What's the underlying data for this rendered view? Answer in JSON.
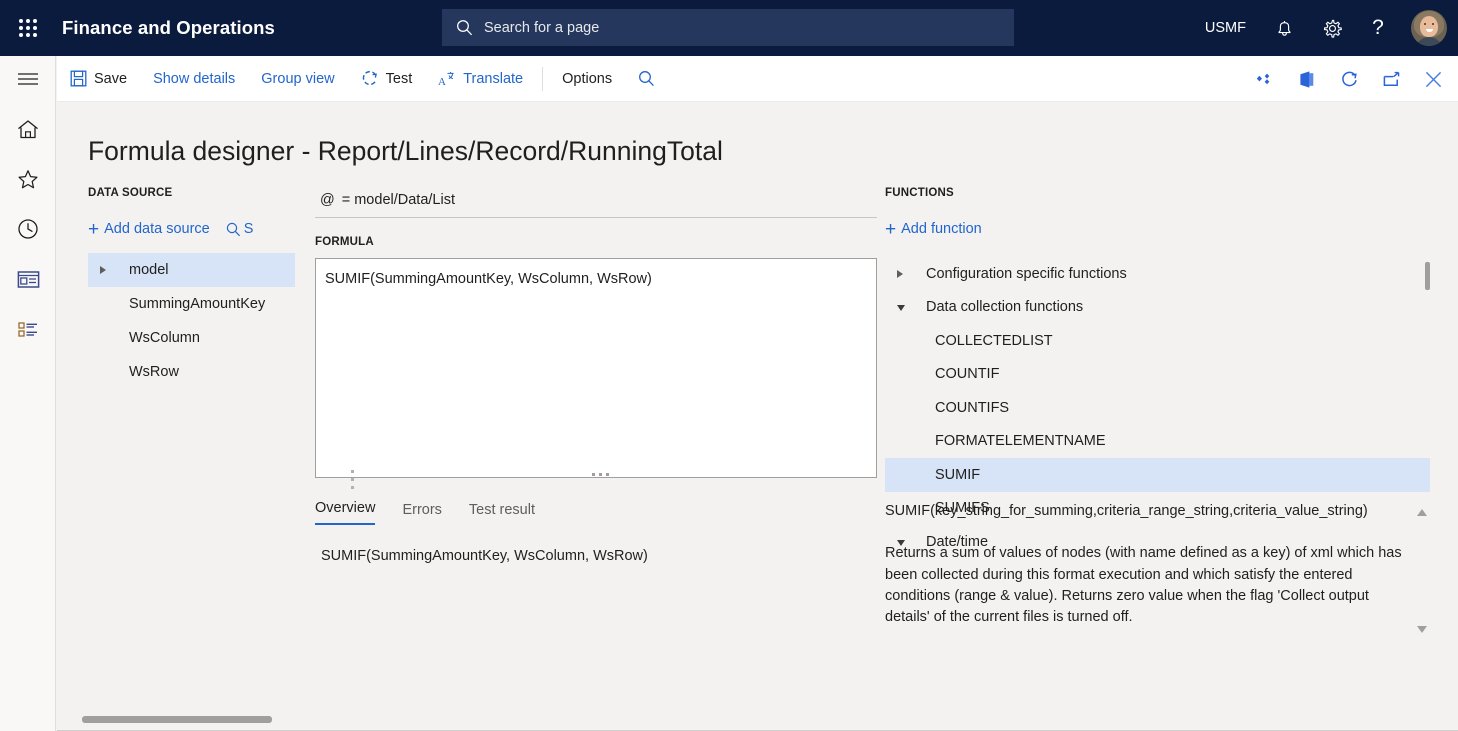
{
  "topbar": {
    "waffle_icon": "app-launcher-icon",
    "app_title": "Finance and Operations",
    "search": {
      "placeholder": "Search for a page",
      "icon": "search-icon"
    },
    "company": "USMF",
    "notifications_icon": "bell-icon",
    "settings_icon": "gear-icon",
    "help_label": "?",
    "avatar": "user-avatar"
  },
  "rail": {
    "items": [
      {
        "name": "hamburger-menu-icon",
        "label": "Expand the navigation pane"
      },
      {
        "name": "home-icon",
        "label": "Home"
      },
      {
        "name": "star-icon",
        "label": "Favorites"
      },
      {
        "name": "clock-icon",
        "label": "Recent"
      },
      {
        "name": "workspaces-icon",
        "label": "Workspaces"
      },
      {
        "name": "modules-list-icon",
        "label": "Modules"
      }
    ]
  },
  "commandbar": {
    "save_label": "Save",
    "show_details_label": "Show details",
    "group_view_label": "Group view",
    "test_label": "Test",
    "translate_label": "Translate",
    "options_label": "Options",
    "search_icon": "search-icon",
    "right_icons": [
      "share-diamond-icon",
      "office-app-icon",
      "refresh-icon",
      "popout-icon",
      "close-icon"
    ]
  },
  "page": {
    "title": "Formula designer - Report/Lines/Record/RunningTotal"
  },
  "datasource": {
    "section_label": "DATA SOURCE",
    "add_label": "Add data source",
    "search_label": "S",
    "tree": [
      {
        "label": "model",
        "indent": 0,
        "expander": "collapsed",
        "selected": true
      },
      {
        "label": "SummingAmountKey",
        "indent": 1,
        "expander": "none",
        "selected": false
      },
      {
        "label": "WsColumn",
        "indent": 1,
        "expander": "none",
        "selected": false
      },
      {
        "label": "WsRow",
        "indent": 1,
        "expander": "none",
        "selected": false
      }
    ]
  },
  "center": {
    "binding_symbol": "@",
    "binding_value": "= model/Data/List",
    "formula_label": "FORMULA",
    "formula_value": "SUMIF(SummingAmountKey, WsColumn, WsRow)",
    "tabs": [
      {
        "label": "Overview",
        "active": true
      },
      {
        "label": "Errors",
        "active": false
      },
      {
        "label": "Test result",
        "active": false
      }
    ],
    "overview_text": "SUMIF(SummingAmountKey, WsColumn, WsRow)"
  },
  "functions": {
    "section_label": "FUNCTIONS",
    "add_label": "Add function",
    "tree": [
      {
        "label": "Configuration specific functions",
        "type": "group",
        "expander": "collapsed",
        "selected": false
      },
      {
        "label": "Data collection functions",
        "type": "group",
        "expander": "expanded",
        "selected": false
      },
      {
        "label": "COLLECTEDLIST",
        "type": "leaf",
        "expander": "none",
        "selected": false
      },
      {
        "label": "COUNTIF",
        "type": "leaf",
        "expander": "none",
        "selected": false
      },
      {
        "label": "COUNTIFS",
        "type": "leaf",
        "expander": "none",
        "selected": false
      },
      {
        "label": "FORMATELEMENTNAME",
        "type": "leaf",
        "expander": "none",
        "selected": false
      },
      {
        "label": "SUMIF",
        "type": "leaf",
        "expander": "none",
        "selected": true
      },
      {
        "label": "SUMIFS",
        "type": "leaf",
        "expander": "none",
        "selected": false
      },
      {
        "label": "Date/time",
        "type": "group",
        "expander": "expanded",
        "selected": false
      }
    ],
    "description": {
      "signature": "SUMIF(key_string_for_summing,criteria_range_string,criteria_value_string)",
      "body": "Returns a sum of values of nodes (with name defined as a key) of xml which has been collected during this format execution and which satisfy the entered conditions (range & value). Returns zero value when the flag 'Collect output details' of the current files is turned off."
    }
  },
  "colors": {
    "nav_background": "#0b1b3d",
    "accent_link": "#2266cc",
    "selection": "#d7e3f7",
    "page_background": "#f3f2f1"
  }
}
